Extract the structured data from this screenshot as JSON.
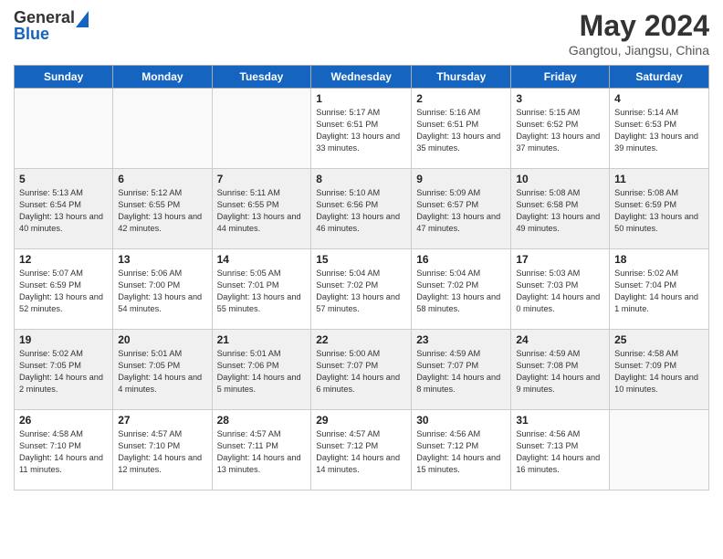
{
  "header": {
    "logo_general": "General",
    "logo_blue": "Blue",
    "main_title": "May 2024",
    "subtitle": "Gangtou, Jiangsu, China"
  },
  "weekdays": [
    "Sunday",
    "Monday",
    "Tuesday",
    "Wednesday",
    "Thursday",
    "Friday",
    "Saturday"
  ],
  "weeks": [
    [
      {
        "day": "",
        "sunrise": "",
        "sunset": "",
        "daylight": ""
      },
      {
        "day": "",
        "sunrise": "",
        "sunset": "",
        "daylight": ""
      },
      {
        "day": "",
        "sunrise": "",
        "sunset": "",
        "daylight": ""
      },
      {
        "day": "1",
        "sunrise": "Sunrise: 5:17 AM",
        "sunset": "Sunset: 6:51 PM",
        "daylight": "Daylight: 13 hours and 33 minutes."
      },
      {
        "day": "2",
        "sunrise": "Sunrise: 5:16 AM",
        "sunset": "Sunset: 6:51 PM",
        "daylight": "Daylight: 13 hours and 35 minutes."
      },
      {
        "day": "3",
        "sunrise": "Sunrise: 5:15 AM",
        "sunset": "Sunset: 6:52 PM",
        "daylight": "Daylight: 13 hours and 37 minutes."
      },
      {
        "day": "4",
        "sunrise": "Sunrise: 5:14 AM",
        "sunset": "Sunset: 6:53 PM",
        "daylight": "Daylight: 13 hours and 39 minutes."
      }
    ],
    [
      {
        "day": "5",
        "sunrise": "Sunrise: 5:13 AM",
        "sunset": "Sunset: 6:54 PM",
        "daylight": "Daylight: 13 hours and 40 minutes."
      },
      {
        "day": "6",
        "sunrise": "Sunrise: 5:12 AM",
        "sunset": "Sunset: 6:55 PM",
        "daylight": "Daylight: 13 hours and 42 minutes."
      },
      {
        "day": "7",
        "sunrise": "Sunrise: 5:11 AM",
        "sunset": "Sunset: 6:55 PM",
        "daylight": "Daylight: 13 hours and 44 minutes."
      },
      {
        "day": "8",
        "sunrise": "Sunrise: 5:10 AM",
        "sunset": "Sunset: 6:56 PM",
        "daylight": "Daylight: 13 hours and 46 minutes."
      },
      {
        "day": "9",
        "sunrise": "Sunrise: 5:09 AM",
        "sunset": "Sunset: 6:57 PM",
        "daylight": "Daylight: 13 hours and 47 minutes."
      },
      {
        "day": "10",
        "sunrise": "Sunrise: 5:08 AM",
        "sunset": "Sunset: 6:58 PM",
        "daylight": "Daylight: 13 hours and 49 minutes."
      },
      {
        "day": "11",
        "sunrise": "Sunrise: 5:08 AM",
        "sunset": "Sunset: 6:59 PM",
        "daylight": "Daylight: 13 hours and 50 minutes."
      }
    ],
    [
      {
        "day": "12",
        "sunrise": "Sunrise: 5:07 AM",
        "sunset": "Sunset: 6:59 PM",
        "daylight": "Daylight: 13 hours and 52 minutes."
      },
      {
        "day": "13",
        "sunrise": "Sunrise: 5:06 AM",
        "sunset": "Sunset: 7:00 PM",
        "daylight": "Daylight: 13 hours and 54 minutes."
      },
      {
        "day": "14",
        "sunrise": "Sunrise: 5:05 AM",
        "sunset": "Sunset: 7:01 PM",
        "daylight": "Daylight: 13 hours and 55 minutes."
      },
      {
        "day": "15",
        "sunrise": "Sunrise: 5:04 AM",
        "sunset": "Sunset: 7:02 PM",
        "daylight": "Daylight: 13 hours and 57 minutes."
      },
      {
        "day": "16",
        "sunrise": "Sunrise: 5:04 AM",
        "sunset": "Sunset: 7:02 PM",
        "daylight": "Daylight: 13 hours and 58 minutes."
      },
      {
        "day": "17",
        "sunrise": "Sunrise: 5:03 AM",
        "sunset": "Sunset: 7:03 PM",
        "daylight": "Daylight: 14 hours and 0 minutes."
      },
      {
        "day": "18",
        "sunrise": "Sunrise: 5:02 AM",
        "sunset": "Sunset: 7:04 PM",
        "daylight": "Daylight: 14 hours and 1 minute."
      }
    ],
    [
      {
        "day": "19",
        "sunrise": "Sunrise: 5:02 AM",
        "sunset": "Sunset: 7:05 PM",
        "daylight": "Daylight: 14 hours and 2 minutes."
      },
      {
        "day": "20",
        "sunrise": "Sunrise: 5:01 AM",
        "sunset": "Sunset: 7:05 PM",
        "daylight": "Daylight: 14 hours and 4 minutes."
      },
      {
        "day": "21",
        "sunrise": "Sunrise: 5:01 AM",
        "sunset": "Sunset: 7:06 PM",
        "daylight": "Daylight: 14 hours and 5 minutes."
      },
      {
        "day": "22",
        "sunrise": "Sunrise: 5:00 AM",
        "sunset": "Sunset: 7:07 PM",
        "daylight": "Daylight: 14 hours and 6 minutes."
      },
      {
        "day": "23",
        "sunrise": "Sunrise: 4:59 AM",
        "sunset": "Sunset: 7:07 PM",
        "daylight": "Daylight: 14 hours and 8 minutes."
      },
      {
        "day": "24",
        "sunrise": "Sunrise: 4:59 AM",
        "sunset": "Sunset: 7:08 PM",
        "daylight": "Daylight: 14 hours and 9 minutes."
      },
      {
        "day": "25",
        "sunrise": "Sunrise: 4:58 AM",
        "sunset": "Sunset: 7:09 PM",
        "daylight": "Daylight: 14 hours and 10 minutes."
      }
    ],
    [
      {
        "day": "26",
        "sunrise": "Sunrise: 4:58 AM",
        "sunset": "Sunset: 7:10 PM",
        "daylight": "Daylight: 14 hours and 11 minutes."
      },
      {
        "day": "27",
        "sunrise": "Sunrise: 4:57 AM",
        "sunset": "Sunset: 7:10 PM",
        "daylight": "Daylight: 14 hours and 12 minutes."
      },
      {
        "day": "28",
        "sunrise": "Sunrise: 4:57 AM",
        "sunset": "Sunset: 7:11 PM",
        "daylight": "Daylight: 14 hours and 13 minutes."
      },
      {
        "day": "29",
        "sunrise": "Sunrise: 4:57 AM",
        "sunset": "Sunset: 7:12 PM",
        "daylight": "Daylight: 14 hours and 14 minutes."
      },
      {
        "day": "30",
        "sunrise": "Sunrise: 4:56 AM",
        "sunset": "Sunset: 7:12 PM",
        "daylight": "Daylight: 14 hours and 15 minutes."
      },
      {
        "day": "31",
        "sunrise": "Sunrise: 4:56 AM",
        "sunset": "Sunset: 7:13 PM",
        "daylight": "Daylight: 14 hours and 16 minutes."
      },
      {
        "day": "",
        "sunrise": "",
        "sunset": "",
        "daylight": ""
      }
    ]
  ]
}
